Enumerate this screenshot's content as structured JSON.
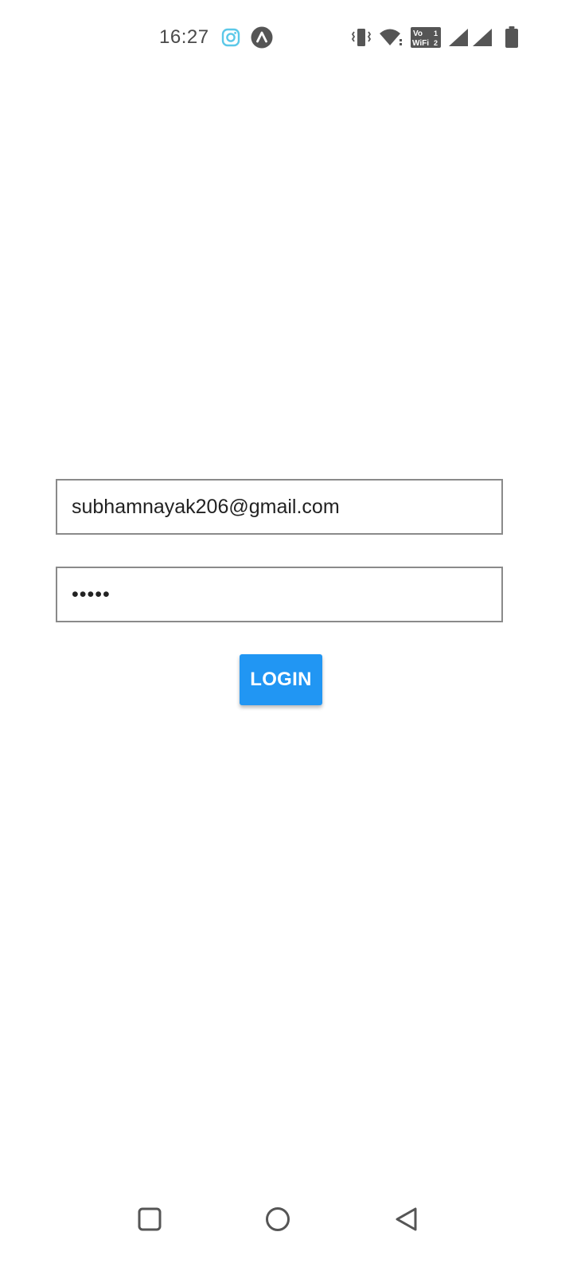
{
  "status_bar": {
    "time": "16:27",
    "icons": [
      "instagram-icon",
      "app-a-icon",
      "vibrate-icon",
      "wifi-icon",
      "vowifi-icon",
      "signal-1-icon",
      "signal-2-icon",
      "battery-icon"
    ],
    "vowifi_line1": "Vo",
    "vowifi_line2": "WiFi",
    "vowifi_sim1": "1",
    "vowifi_sim2": "2"
  },
  "login_form": {
    "email_value": "subhamnayak206@gmail.com",
    "password_value": "•••••",
    "login_label": "LOGIN"
  },
  "nav_bar": {
    "icons": [
      "recent-apps-icon",
      "home-icon",
      "back-icon"
    ]
  },
  "colors": {
    "accent": "#2196f3",
    "status_icons": "#555555",
    "instagram": "#5bc8e8"
  }
}
